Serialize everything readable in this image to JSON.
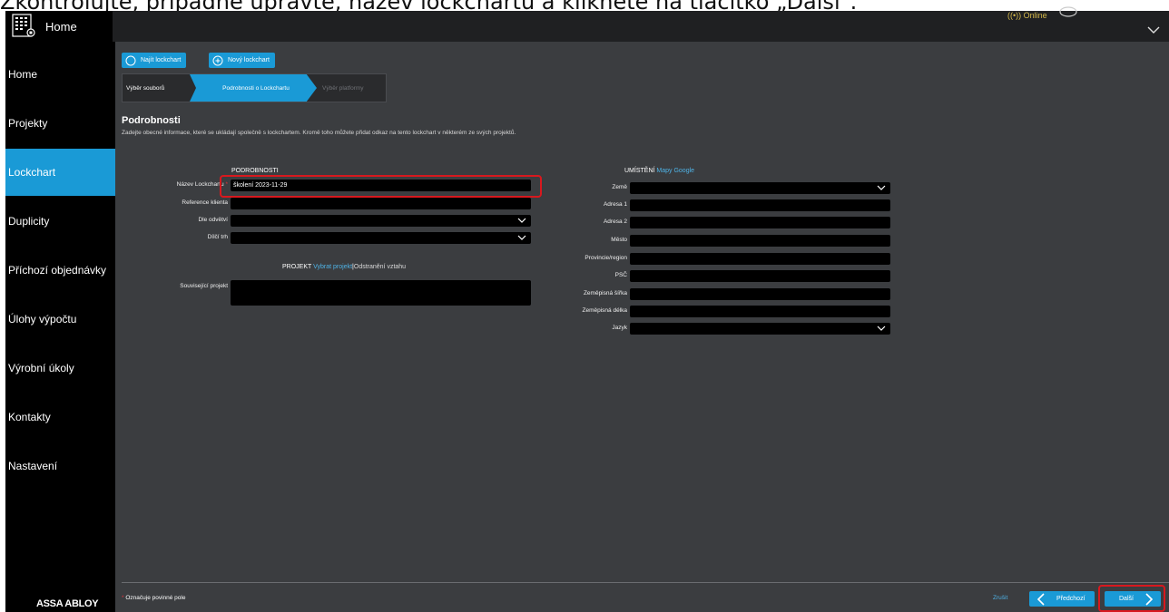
{
  "caption": "Zkontrolujte, případně upravte, název lockchartu a klikněte na tlačítko „Další\".",
  "topbar": {
    "home_label": "Home",
    "status": "((•)) Online"
  },
  "sidebar": {
    "items": [
      {
        "label": "Home"
      },
      {
        "label": "Projekty"
      },
      {
        "label": "Lockchart"
      },
      {
        "label": "Duplicity"
      },
      {
        "label": "Příchozí objednávky"
      },
      {
        "label": "Úlohy výpočtu"
      },
      {
        "label": "Výrobní úkoly"
      },
      {
        "label": "Kontakty"
      },
      {
        "label": "Nastavení"
      }
    ],
    "active_index": 2,
    "brand": "ASSA ABLOY"
  },
  "toolbar": {
    "find_label": "Najít lockchart",
    "new_label": "Nový lockchart"
  },
  "wizard": {
    "steps": [
      "Výběr souborů",
      "Podrobnosti o Lockchartu",
      "Výběr platformy"
    ],
    "current": 1
  },
  "section": {
    "title": "Podrobnosti",
    "description": "Zadejte obecné informace, které se ukládají společně s lockchartem. Kromě toho můžete přidat odkaz na tento lockchart v některém ze svých projektů."
  },
  "details": {
    "heading": "PODROBNOSTI",
    "fields": [
      {
        "label": "Název Lockchartu",
        "required": "*",
        "value": "školení 2023-11-29"
      },
      {
        "label": "Reference klienta",
        "value": ""
      },
      {
        "label": "Dle odvětví",
        "value": ""
      },
      {
        "label": "Dílčí trh",
        "value": ""
      }
    ]
  },
  "project": {
    "heading": "PROJEKT",
    "select_link": "Vybrat projekt",
    "separator": "|",
    "remove_link": "Odstranění vztahu",
    "related_label": "Související projekt",
    "related_value": ""
  },
  "location": {
    "heading": "UMÍSTĚNÍ",
    "maps_link": "Mapy Google",
    "fields": [
      {
        "label": "Země",
        "value": ""
      },
      {
        "label": "Adresa 1",
        "value": ""
      },
      {
        "label": "Adresa 2",
        "value": ""
      },
      {
        "label": "Město",
        "value": ""
      },
      {
        "label": "Provincie/region",
        "value": ""
      },
      {
        "label": "PSČ",
        "value": ""
      },
      {
        "label": "Zeměpisná šířka",
        "value": ""
      },
      {
        "label": "Zeměpisná délka",
        "value": ""
      },
      {
        "label": "Jazyk",
        "value": ""
      }
    ]
  },
  "footer": {
    "required_mark": "*",
    "required_note": "Označuje povinné pole",
    "cancel": "Zrušit",
    "prev": "Předchozí",
    "next": "Další"
  },
  "colors": {
    "accent": "#1a9ad6",
    "highlight": "#d8181e",
    "status": "#d4b84a"
  }
}
